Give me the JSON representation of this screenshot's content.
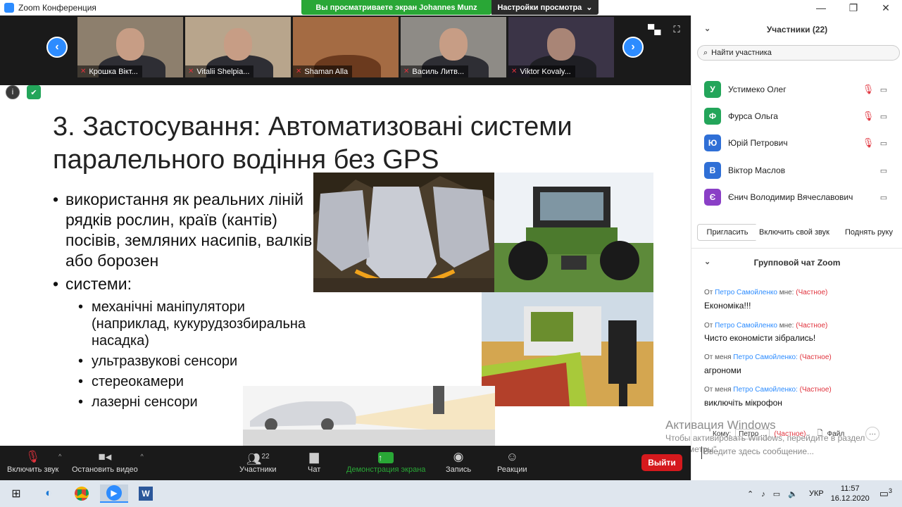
{
  "window": {
    "title": "Zoom Конференция",
    "controls": {
      "minimize": "—",
      "maximize": "❐",
      "close": "✕"
    }
  },
  "share": {
    "banner": "Вы просматриваете экран Johannes Munz",
    "view_options": "Настройки просмотра",
    "view_options_caret": "⌄"
  },
  "video_strip": {
    "prev_icon": "‹",
    "next_icon": "›",
    "tiles": [
      {
        "name": "Крошка Вікт...",
        "bg": "#8d7f6d"
      },
      {
        "name": "Vitalii Shelpia...",
        "bg": "#b8a58c"
      },
      {
        "name": "Shaman Alla",
        "bg": "#a46b43"
      },
      {
        "name": "Василь Литв...",
        "bg": "#8e8b86"
      },
      {
        "name": "Viktor Kovaly...",
        "bg": "#3b3447"
      }
    ]
  },
  "slide": {
    "info_icon": "i",
    "shield_icon": "✔",
    "title": "3. Застосування: Автоматизовані системи паралельного водіння без GPS",
    "bullet1": "використання як реальних ліній рядків рослин, країв (кантів) посівів, земляних насипів, валків або борозен",
    "bullet2": "системи:",
    "sub1": "механічні маніпулятори (наприклад, кукурудзозбиральна насадка)",
    "sub2": "ультразвукові сенсори",
    "sub3": "стереокамери",
    "sub4": "лазерні сенсори"
  },
  "participants": {
    "header": "Участники (22)",
    "collapse_icon": "⌄",
    "search_placeholder": "Найти участника",
    "list": [
      {
        "initial": "У",
        "name": "Устимеко Олег",
        "color": "#23a55a",
        "muted": true
      },
      {
        "initial": "Ф",
        "name": "Фурса Ольга",
        "color": "#23a55a",
        "muted": true
      },
      {
        "initial": "Ю",
        "name": "Юрій Петрович",
        "color": "#2f6fd6",
        "muted": true
      },
      {
        "initial": "В",
        "name": "Віктор Маслов",
        "color": "#2f6fd6",
        "muted": false
      },
      {
        "initial": "Є",
        "name": "Єнич Володимир Вячеславович",
        "color": "#8a3fc6",
        "muted": false
      }
    ],
    "muted_mic_icon": "⚡",
    "camera_icon": "▭",
    "invite": "Пригласить",
    "unmute_me": "Включить свой звук",
    "raise_hand": "Поднять руку"
  },
  "chat": {
    "header": "Групповой чат Zoom",
    "messages": [
      {
        "prefix": "От",
        "who": "Петро Самойленко",
        "suffix": "мне:",
        "priv": "(Частное)",
        "text": "Економіка!!!"
      },
      {
        "prefix": "От",
        "who": "Петро Самойленко",
        "suffix": "мне:",
        "priv": "(Частное)",
        "text": "Чисто економісти зібрались!"
      },
      {
        "prefix": "От меня",
        "who": "Петро Самойленко:",
        "suffix": "",
        "priv": "(Частное)",
        "text": "агрономи"
      },
      {
        "prefix": "От меня",
        "who": "Петро Самойленко:",
        "suffix": "",
        "priv": "(Частное)",
        "text": "виключіть мікрофон"
      }
    ],
    "to_label": "Кому:",
    "to_value": "Петро ...",
    "to_priv": "(Частное)",
    "file_label": "Файл",
    "more": "···",
    "input_placeholder": "Введите здесь сообщение..."
  },
  "watermark": {
    "line1": "Активация Windows",
    "line2": "Чтобы активировать Windows, перейдите в раздел \"Параметры\"."
  },
  "toolbar": {
    "unmute": "Включить звук",
    "stop_video": "Остановить видео",
    "participants": "Участники",
    "participants_count": "22",
    "chat": "Чат",
    "share": "Демонстрация экрана",
    "record": "Запись",
    "reactions": "Реакции",
    "leave": "Выйти",
    "caret": "^"
  },
  "taskbar": {
    "lang": "УКР",
    "time": "11:57",
    "date": "16.12.2020",
    "notifications": "3",
    "tray_icons": "⌃  ♪  ▭  🔈"
  }
}
